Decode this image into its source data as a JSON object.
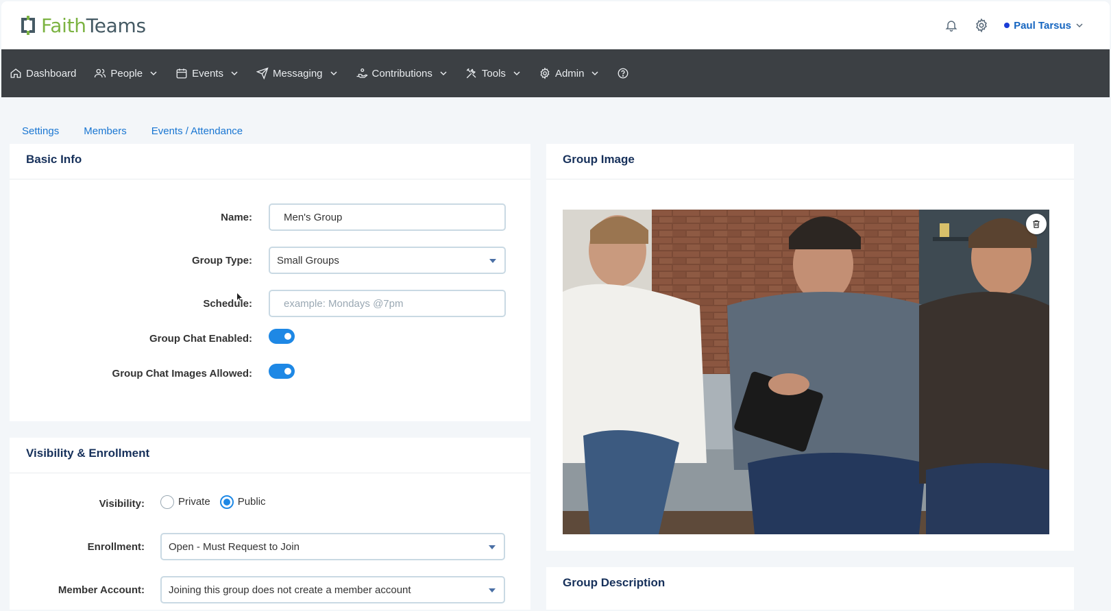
{
  "header": {
    "logo": {
      "part1": "Faith",
      "part2": "Teams"
    },
    "user_name": "Paul Tarsus",
    "icons": [
      "bell-icon",
      "gear-icon",
      "chevron-down-icon"
    ]
  },
  "navbar": {
    "items": [
      {
        "label": "Dashboard",
        "icon": "home-icon",
        "has_dropdown": false
      },
      {
        "label": "People",
        "icon": "people-icon",
        "has_dropdown": true
      },
      {
        "label": "Events",
        "icon": "calendar-icon",
        "has_dropdown": true
      },
      {
        "label": "Messaging",
        "icon": "paper-plane-icon",
        "has_dropdown": true
      },
      {
        "label": "Contributions",
        "icon": "hand-coin-icon",
        "has_dropdown": true
      },
      {
        "label": "Tools",
        "icon": "tools-icon",
        "has_dropdown": true
      },
      {
        "label": "Admin",
        "icon": "gear-icon",
        "has_dropdown": true
      }
    ],
    "help_icon": "help-circle-icon"
  },
  "tabs": [
    {
      "label": "Settings",
      "active": true
    },
    {
      "label": "Members",
      "active": false
    },
    {
      "label": "Events / Attendance",
      "active": false
    }
  ],
  "basic_info": {
    "title": "Basic Info",
    "name_label": "Name:",
    "name_value": "Men's Group",
    "group_type_label": "Group Type:",
    "group_type_value": "Small Groups",
    "schedule_label": "Schedule:",
    "schedule_placeholder": "example: Mondays @7pm",
    "chat_enabled_label": "Group Chat Enabled:",
    "chat_enabled": true,
    "chat_images_label": "Group Chat Images Allowed:",
    "chat_images": true
  },
  "visibility": {
    "title": "Visibility & Enrollment",
    "visibility_label": "Visibility:",
    "options": [
      "Private",
      "Public"
    ],
    "selected": "Public",
    "enrollment_label": "Enrollment:",
    "enrollment_value": "Open - Must Request to Join",
    "member_account_label": "Member Account:",
    "member_account_value": "Joining this group does not create a member account"
  },
  "group_image": {
    "title": "Group Image",
    "delete_icon": "trash-icon"
  },
  "group_description": {
    "title": "Group Description"
  },
  "colors": {
    "accent": "#1e88e5",
    "navbar_bg": "#3c4044",
    "logo_green": "#7cb342",
    "logo_gray": "#455a64",
    "heading": "#16305a"
  }
}
